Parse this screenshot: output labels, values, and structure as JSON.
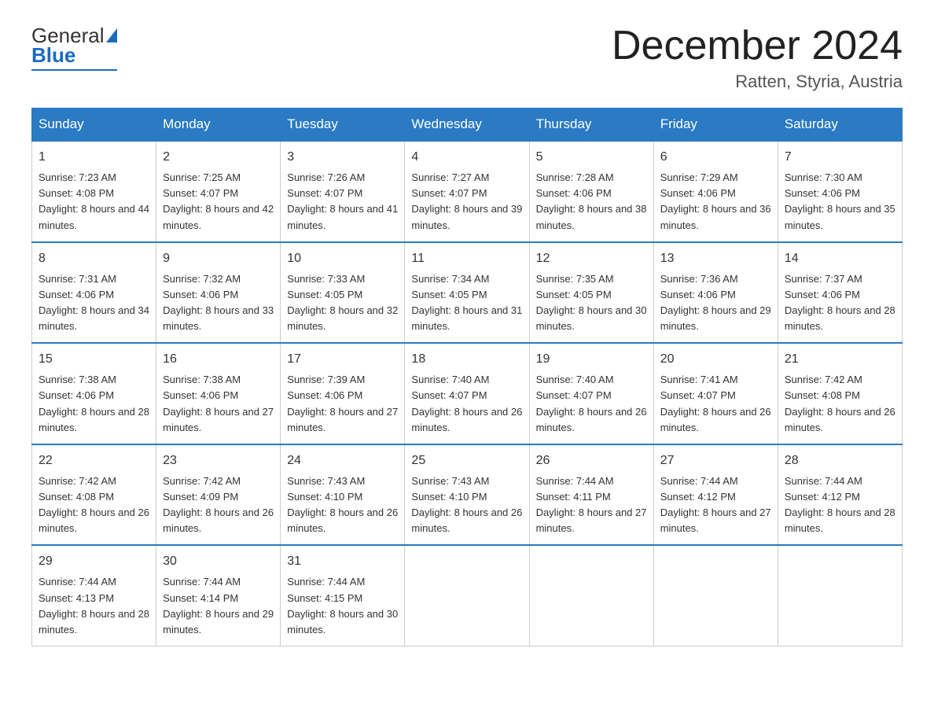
{
  "header": {
    "logo": {
      "general": "General",
      "blue": "Blue"
    },
    "title": "December 2024",
    "location": "Ratten, Styria, Austria"
  },
  "weekdays": [
    "Sunday",
    "Monday",
    "Tuesday",
    "Wednesday",
    "Thursday",
    "Friday",
    "Saturday"
  ],
  "weeks": [
    [
      {
        "day": "1",
        "sunrise": "7:23 AM",
        "sunset": "4:08 PM",
        "daylight": "8 hours and 44 minutes."
      },
      {
        "day": "2",
        "sunrise": "7:25 AM",
        "sunset": "4:07 PM",
        "daylight": "8 hours and 42 minutes."
      },
      {
        "day": "3",
        "sunrise": "7:26 AM",
        "sunset": "4:07 PM",
        "daylight": "8 hours and 41 minutes."
      },
      {
        "day": "4",
        "sunrise": "7:27 AM",
        "sunset": "4:07 PM",
        "daylight": "8 hours and 39 minutes."
      },
      {
        "day": "5",
        "sunrise": "7:28 AM",
        "sunset": "4:06 PM",
        "daylight": "8 hours and 38 minutes."
      },
      {
        "day": "6",
        "sunrise": "7:29 AM",
        "sunset": "4:06 PM",
        "daylight": "8 hours and 36 minutes."
      },
      {
        "day": "7",
        "sunrise": "7:30 AM",
        "sunset": "4:06 PM",
        "daylight": "8 hours and 35 minutes."
      }
    ],
    [
      {
        "day": "8",
        "sunrise": "7:31 AM",
        "sunset": "4:06 PM",
        "daylight": "8 hours and 34 minutes."
      },
      {
        "day": "9",
        "sunrise": "7:32 AM",
        "sunset": "4:06 PM",
        "daylight": "8 hours and 33 minutes."
      },
      {
        "day": "10",
        "sunrise": "7:33 AM",
        "sunset": "4:05 PM",
        "daylight": "8 hours and 32 minutes."
      },
      {
        "day": "11",
        "sunrise": "7:34 AM",
        "sunset": "4:05 PM",
        "daylight": "8 hours and 31 minutes."
      },
      {
        "day": "12",
        "sunrise": "7:35 AM",
        "sunset": "4:05 PM",
        "daylight": "8 hours and 30 minutes."
      },
      {
        "day": "13",
        "sunrise": "7:36 AM",
        "sunset": "4:06 PM",
        "daylight": "8 hours and 29 minutes."
      },
      {
        "day": "14",
        "sunrise": "7:37 AM",
        "sunset": "4:06 PM",
        "daylight": "8 hours and 28 minutes."
      }
    ],
    [
      {
        "day": "15",
        "sunrise": "7:38 AM",
        "sunset": "4:06 PM",
        "daylight": "8 hours and 28 minutes."
      },
      {
        "day": "16",
        "sunrise": "7:38 AM",
        "sunset": "4:06 PM",
        "daylight": "8 hours and 27 minutes."
      },
      {
        "day": "17",
        "sunrise": "7:39 AM",
        "sunset": "4:06 PM",
        "daylight": "8 hours and 27 minutes."
      },
      {
        "day": "18",
        "sunrise": "7:40 AM",
        "sunset": "4:07 PM",
        "daylight": "8 hours and 26 minutes."
      },
      {
        "day": "19",
        "sunrise": "7:40 AM",
        "sunset": "4:07 PM",
        "daylight": "8 hours and 26 minutes."
      },
      {
        "day": "20",
        "sunrise": "7:41 AM",
        "sunset": "4:07 PM",
        "daylight": "8 hours and 26 minutes."
      },
      {
        "day": "21",
        "sunrise": "7:42 AM",
        "sunset": "4:08 PM",
        "daylight": "8 hours and 26 minutes."
      }
    ],
    [
      {
        "day": "22",
        "sunrise": "7:42 AM",
        "sunset": "4:08 PM",
        "daylight": "8 hours and 26 minutes."
      },
      {
        "day": "23",
        "sunrise": "7:42 AM",
        "sunset": "4:09 PM",
        "daylight": "8 hours and 26 minutes."
      },
      {
        "day": "24",
        "sunrise": "7:43 AM",
        "sunset": "4:10 PM",
        "daylight": "8 hours and 26 minutes."
      },
      {
        "day": "25",
        "sunrise": "7:43 AM",
        "sunset": "4:10 PM",
        "daylight": "8 hours and 26 minutes."
      },
      {
        "day": "26",
        "sunrise": "7:44 AM",
        "sunset": "4:11 PM",
        "daylight": "8 hours and 27 minutes."
      },
      {
        "day": "27",
        "sunrise": "7:44 AM",
        "sunset": "4:12 PM",
        "daylight": "8 hours and 27 minutes."
      },
      {
        "day": "28",
        "sunrise": "7:44 AM",
        "sunset": "4:12 PM",
        "daylight": "8 hours and 28 minutes."
      }
    ],
    [
      {
        "day": "29",
        "sunrise": "7:44 AM",
        "sunset": "4:13 PM",
        "daylight": "8 hours and 28 minutes."
      },
      {
        "day": "30",
        "sunrise": "7:44 AM",
        "sunset": "4:14 PM",
        "daylight": "8 hours and 29 minutes."
      },
      {
        "day": "31",
        "sunrise": "7:44 AM",
        "sunset": "4:15 PM",
        "daylight": "8 hours and 30 minutes."
      },
      null,
      null,
      null,
      null
    ]
  ]
}
